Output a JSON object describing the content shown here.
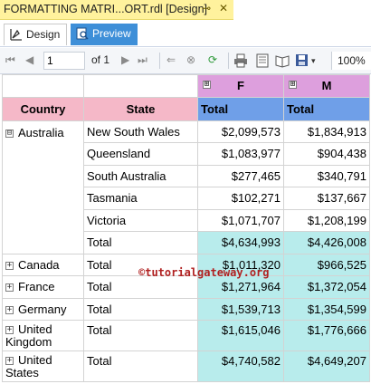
{
  "document_tab": {
    "title": "FORMATTING MATRI...ORT.rdl [Design]",
    "pin_icon": "⊸",
    "close_icon": "✕"
  },
  "view_tabs": [
    {
      "label": "Design",
      "icon": "design-icon",
      "active": true
    },
    {
      "label": "Preview",
      "icon": "preview-icon",
      "active": false
    }
  ],
  "toolbar": {
    "page_value": "1",
    "of_label": "of 1",
    "zoom": "100%"
  },
  "matrix": {
    "column_groups": [
      {
        "label": "F",
        "expander": "⊞"
      },
      {
        "label": "M",
        "expander": "⊞"
      }
    ],
    "header": {
      "country": "Country",
      "state": "State",
      "total_f": "Total",
      "total_m": "Total"
    },
    "australia": {
      "country": "Australia",
      "expander": "⊟",
      "rows": [
        {
          "state": "New South Wales",
          "f": "$2,099,573",
          "m": "$1,834,913"
        },
        {
          "state": "Queensland",
          "f": "$1,083,977",
          "m": "$904,438"
        },
        {
          "state": "South Australia",
          "f": "$277,465",
          "m": "$340,791"
        },
        {
          "state": "Tasmania",
          "f": "$102,271",
          "m": "$137,667"
        },
        {
          "state": "Victoria",
          "f": "$1,071,707",
          "m": "$1,208,199"
        },
        {
          "state": "Total",
          "f": "$4,634,993",
          "m": "$4,426,008"
        }
      ]
    },
    "collapsed_countries": [
      {
        "country": "Canada",
        "state": "Total",
        "f": "$1,011,320",
        "m": "$966,525"
      },
      {
        "country": "France",
        "state": "Total",
        "f": "$1,271,964",
        "m": "$1,372,054"
      },
      {
        "country": "Germany",
        "state": "Total",
        "f": "$1,539,713",
        "m": "$1,354,599"
      },
      {
        "country": "United Kingdom",
        "state": "Total",
        "f": "$1,615,046",
        "m": "$1,776,666"
      },
      {
        "country": "United States",
        "state": "Total",
        "f": "$4,740,582",
        "m": "$4,649,207"
      }
    ]
  },
  "watermark": "©tutorialgateway.org",
  "colors": {
    "doc_tab": "#fff29d",
    "preview_tab": "#3e8fd8",
    "gender_header": "#dd9fdd",
    "country_header": "#f5b8c8",
    "total_header": "#6f9fe8",
    "total_cells": "#b8ecec"
  }
}
